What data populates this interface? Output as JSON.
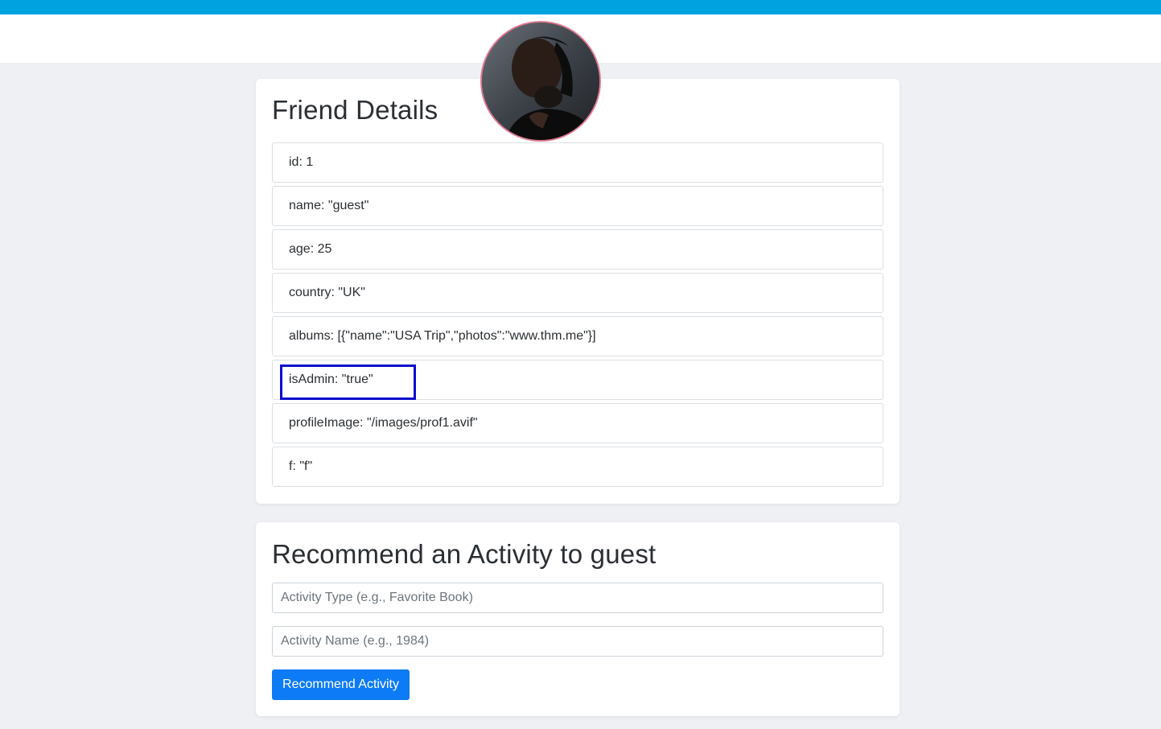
{
  "details": {
    "title": "Friend Details",
    "items": [
      {
        "text": "id: 1"
      },
      {
        "text": "name: \"guest\""
      },
      {
        "text": "age: 25"
      },
      {
        "text": "country: \"UK\""
      },
      {
        "text": "albums: [{\"name\":\"USA Trip\",\"photos\":\"www.thm.me\"}]"
      },
      {
        "text": "isAdmin: \"true\""
      },
      {
        "text": "profileImage: \"/images/prof1.avif\""
      },
      {
        "text": "f: \"f\""
      }
    ]
  },
  "recommend": {
    "title": "Recommend an Activity to guest",
    "activity_type_placeholder": "Activity Type (e.g., Favorite Book)",
    "activity_name_placeholder": "Activity Name (e.g., 1984)",
    "button_label": "Recommend Activity"
  },
  "colors": {
    "top_bar": "#00a3e0",
    "button": "#0d7bf5",
    "highlight": "#0a0acd",
    "avatar_border": "#e07a90"
  }
}
